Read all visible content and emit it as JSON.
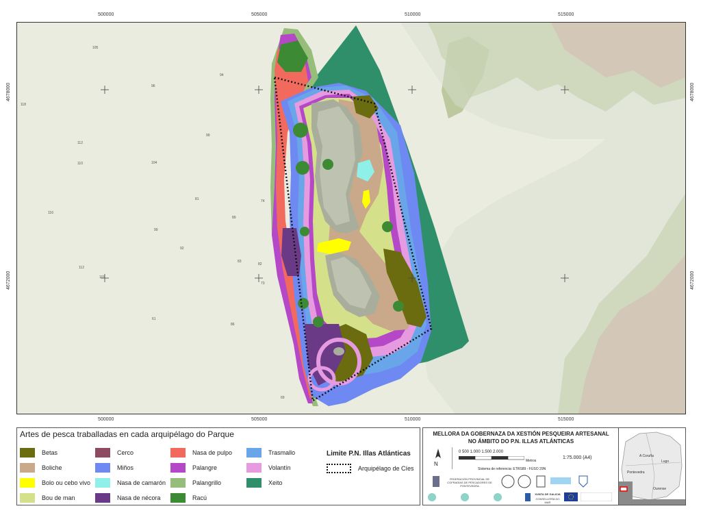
{
  "map": {
    "x_ticks": [
      "500000",
      "505000",
      "510000",
      "515000"
    ],
    "y_ticks": [
      "4678000",
      "4672000"
    ],
    "depth_soundings_left": [
      "105",
      "118",
      "112",
      "110",
      "116",
      "112",
      "101",
      "96",
      "94",
      "99",
      "104",
      "99",
      "92",
      "89",
      "81",
      "86",
      "83",
      "61",
      "74",
      "73",
      "69",
      "82"
    ]
  },
  "legend": {
    "title": "Artes de pesca traballadas en cada arquipélago do Parque",
    "items": [
      {
        "label": "Betas",
        "color": "#6b6b0f"
      },
      {
        "label": "Boliche",
        "color": "#c9a98a"
      },
      {
        "label": "Bolo ou cebo vivo",
        "color": "#ffff00"
      },
      {
        "label": "Bou de man",
        "color": "#d5e08a"
      },
      {
        "label": "Cerco",
        "color": "#8e4a60"
      },
      {
        "label": "Miños",
        "color": "#6f89f2"
      },
      {
        "label": "Nasa de camarón",
        "color": "#8ff0ea"
      },
      {
        "label": "Nasa de nécora",
        "color": "#6a3a87"
      },
      {
        "label": "Nasa de pulpo",
        "color": "#f26a5e"
      },
      {
        "label": "Palangre",
        "color": "#b548c7"
      },
      {
        "label": "Palangrillo",
        "color": "#97bd7a"
      },
      {
        "label": "Racú",
        "color": "#3c8a33"
      },
      {
        "label": "Trasmallo",
        "color": "#69a6e9"
      },
      {
        "label": "Volantín",
        "color": "#e69ae0"
      },
      {
        "label": "Xeito",
        "color": "#2f8f6b"
      }
    ],
    "limit_title": "Limite P.N. Illas Atlánticas",
    "limit_item": "Arquipélago de Cíes"
  },
  "info": {
    "title_line1": "MELLORA DA GOBERNAZA DA XESTIÓN PESQUEIRA ARTESANAL",
    "title_line2": "NO ÁMBITO DO P.N. ILLAS ATLÁNTICAS",
    "north": "N",
    "scale_marks": "0   500  1.000  1.500  2.000",
    "scale_units": "Metros",
    "scale_ratio": "1:75.000 (A4)",
    "reference": "Sistema de referencia: ETRS89 - FUSO 29N",
    "logo_federation": "FEDERACIÓN PROVINCIAL DE COFRADÍAS DE PESCADORES DE PONTEVEDRA",
    "logo_xunta": "XUNTA DE GALICIA",
    "logo_conselleria": "CONSELLERÍA DO MAR"
  },
  "locator": {
    "labels": [
      "A Coruña",
      "Lugo",
      "Pontevedra",
      "Ourense"
    ]
  }
}
